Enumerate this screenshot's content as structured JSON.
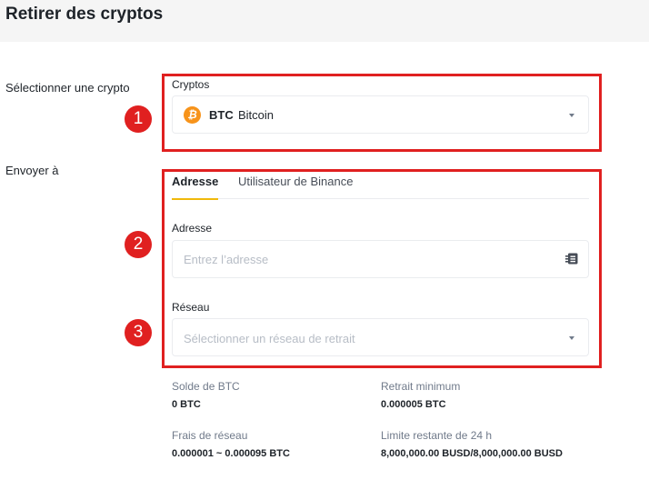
{
  "page": {
    "title": "Retirer des cryptos"
  },
  "rows": {
    "select_crypto_label": "Sélectionner une crypto",
    "send_to_label": "Envoyer à"
  },
  "crypto_select": {
    "label": "Cryptos",
    "symbol": "BTC",
    "name": "Bitcoin",
    "icon": "bitcoin-icon",
    "icon_glyph": "₿",
    "icon_color": "#f7931a"
  },
  "tabs": [
    {
      "label": "Adresse",
      "active": true
    },
    {
      "label": "Utilisateur de Binance",
      "active": false
    }
  ],
  "address": {
    "label": "Adresse",
    "value": "",
    "placeholder": "Entrez l’adresse",
    "icon": "address-book-icon"
  },
  "network": {
    "label": "Réseau",
    "placeholder": "Sélectionner un réseau de retrait"
  },
  "info": {
    "balance_label": "Solde de BTC",
    "balance_value": "0 BTC",
    "min_label": "Retrait minimum",
    "min_value": "0.000005 BTC",
    "fee_label": "Frais de réseau",
    "fee_value": "0.000001 ~ 0.000095 BTC",
    "limit_label": "Limite restante de 24 h",
    "limit_value": "8,000,000.00 BUSD/8,000,000.00 BUSD"
  },
  "annotations": {
    "badge_1": "1",
    "badge_2": "2",
    "badge_3": "3",
    "color": "#e02020"
  },
  "colors": {
    "accent": "#f0b90b",
    "text": "#1e2329",
    "muted": "#707a8a",
    "border": "#eaecef"
  }
}
